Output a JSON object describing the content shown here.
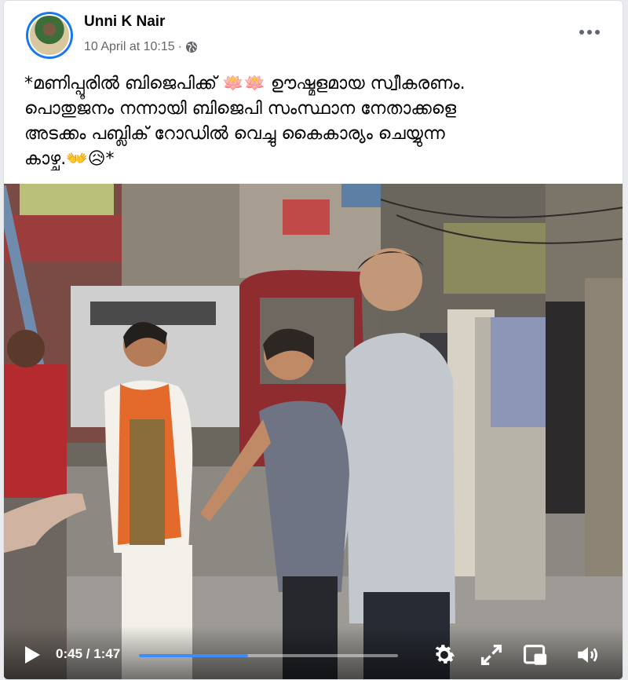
{
  "post": {
    "author": "Unni K Nair",
    "date": "10 April at 10:15",
    "separator": "·",
    "privacy_icon": "globe-icon",
    "more_icon": "more-options-icon",
    "text_lines": [
      "*മണിപ്പൂരിൽ ബിജെപിക്ക് 🪷🪷 ഊഷ്മളമായ സ്വീകരണം.",
      "പൊതുജനം നന്നായി ബിജെപി സംസ്ഥാന നേതാക്കളെ",
      "അടക്കം പബ്ലിക് റോഡിൽ വെച്ചു കൈകാര്യം ചെയ്യുന്ന",
      "കാഴ്ച.👐😥*"
    ]
  },
  "video": {
    "current_time": "0:45",
    "duration": "1:47",
    "time_display": "0:45 / 1:47",
    "progress_fraction": 0.42,
    "accent_color": "#3b8cff",
    "controls": [
      "play-icon",
      "settings-icon",
      "fullscreen-icon",
      "picture-in-picture-icon",
      "volume-icon"
    ]
  }
}
